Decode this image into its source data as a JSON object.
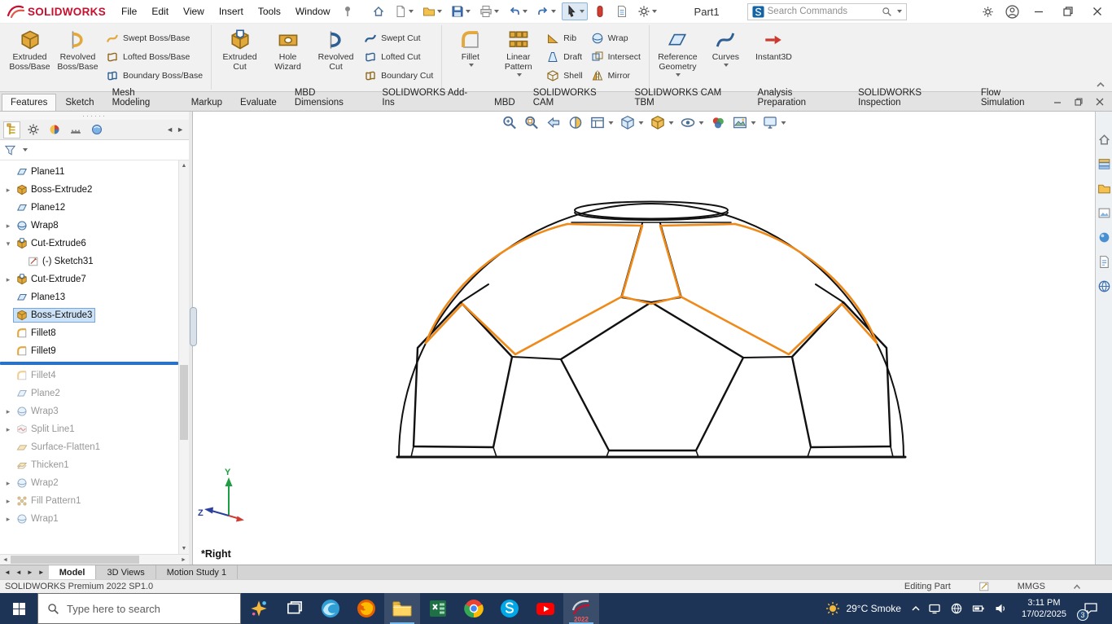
{
  "title_bar": {
    "brand": "SOLIDWORKS",
    "menus": [
      "File",
      "Edit",
      "View",
      "Insert",
      "Tools",
      "Window"
    ],
    "quick_access": [
      {
        "name": "home",
        "caret": false
      },
      {
        "name": "new-document",
        "caret": true
      },
      {
        "name": "open",
        "caret": true
      },
      {
        "name": "save",
        "caret": true
      },
      {
        "name": "print",
        "caret": true
      },
      {
        "name": "undo",
        "caret": true
      },
      {
        "name": "redo",
        "caret": true
      },
      {
        "name": "select",
        "caret": true,
        "active": true
      },
      {
        "name": "rebuild",
        "caret": false
      },
      {
        "name": "file-properties",
        "caret": false
      },
      {
        "name": "options",
        "caret": true
      }
    ],
    "document_title": "Part1",
    "search_placeholder": "Search Commands"
  },
  "ribbon": {
    "groups": [
      {
        "big": [
          {
            "label": "Extruded\nBoss/Base",
            "icon": "extruded-boss"
          },
          {
            "label": "Revolved\nBoss/Base",
            "icon": "revolved-boss"
          }
        ],
        "stacks": [
          [
            {
              "label": "Swept Boss/Base",
              "icon": "swept-boss"
            },
            {
              "label": "Lofted Boss/Base",
              "icon": "lofted-boss"
            },
            {
              "label": "Boundary Boss/Base",
              "icon": "boundary-boss"
            }
          ]
        ]
      },
      {
        "big": [
          {
            "label": "Extruded\nCut",
            "icon": "extruded-cut"
          },
          {
            "label": "Hole\nWizard",
            "icon": "hole-wizard"
          },
          {
            "label": "Revolved\nCut",
            "icon": "revolved-cut"
          }
        ],
        "stacks": [
          [
            {
              "label": "Swept Cut",
              "icon": "swept-cut"
            },
            {
              "label": "Lofted Cut",
              "icon": "lofted-cut"
            },
            {
              "label": "Boundary Cut",
              "icon": "boundary-cut"
            }
          ]
        ]
      },
      {
        "big": [
          {
            "label": "Fillet",
            "icon": "fillet",
            "caret": true
          },
          {
            "label": "Linear\nPattern",
            "icon": "linear-pattern",
            "caret": true
          }
        ],
        "stacks": [
          [
            {
              "label": "Rib",
              "icon": "rib"
            },
            {
              "label": "Draft",
              "icon": "draft"
            },
            {
              "label": "Shell",
              "icon": "shell"
            }
          ],
          [
            {
              "label": "Wrap",
              "icon": "wrap"
            },
            {
              "label": "Intersect",
              "icon": "intersect"
            },
            {
              "label": "Mirror",
              "icon": "mirror"
            }
          ]
        ]
      },
      {
        "big": [
          {
            "label": "Reference\nGeometry",
            "icon": "reference-geometry",
            "caret": true
          },
          {
            "label": "Curves",
            "icon": "curves",
            "caret": true
          },
          {
            "label": "Instant3D",
            "icon": "instant3d"
          }
        ],
        "stacks": []
      }
    ]
  },
  "command_manager": {
    "tabs": [
      {
        "label": "Features",
        "active": true
      },
      {
        "label": "Sketch"
      },
      {
        "label": "Mesh Modeling"
      },
      {
        "label": "Markup"
      },
      {
        "label": "Evaluate"
      },
      {
        "label": "MBD Dimensions"
      },
      {
        "label": "SOLIDWORKS Add-Ins"
      },
      {
        "label": "MBD"
      },
      {
        "label": "SOLIDWORKS CAM"
      },
      {
        "label": "SOLIDWORKS CAM TBM"
      },
      {
        "label": "Analysis Preparation"
      },
      {
        "label": "SOLIDWORKS Inspection"
      },
      {
        "label": "Flow Simulation"
      }
    ]
  },
  "feature_tree": {
    "items": [
      {
        "label": "Plane11",
        "icon": "plane"
      },
      {
        "label": "Boss-Extrude2",
        "icon": "boss-extrude",
        "expand": "collapsed"
      },
      {
        "label": "Plane12",
        "icon": "plane"
      },
      {
        "label": "Wrap8",
        "icon": "wrap",
        "expand": "collapsed"
      },
      {
        "label": "Cut-Extrude6",
        "icon": "cut-extrude",
        "expand": "expanded"
      },
      {
        "label": "(-) Sketch31",
        "icon": "sketch",
        "indent": 1
      },
      {
        "label": "Cut-Extrude7",
        "icon": "cut-extrude",
        "expand": "collapsed"
      },
      {
        "label": "Plane13",
        "icon": "plane"
      },
      {
        "label": "Boss-Extrude3",
        "icon": "boss-extrude",
        "selected": true
      },
      {
        "label": "Fillet8",
        "icon": "fillet"
      },
      {
        "label": "Fillet9",
        "icon": "fillet"
      },
      {
        "label": "Fillet4",
        "icon": "fillet",
        "dimmed": true,
        "rollback_before": true
      },
      {
        "label": "Plane2",
        "icon": "plane",
        "dimmed": true
      },
      {
        "label": "Wrap3",
        "icon": "wrap",
        "expand": "collapsed",
        "dimmed": true
      },
      {
        "label": "Split Line1",
        "icon": "split-line",
        "expand": "collapsed",
        "dimmed": true
      },
      {
        "label": "Surface-Flatten1",
        "icon": "surface-flatten",
        "dimmed": true
      },
      {
        "label": "Thicken1",
        "icon": "thicken",
        "dimmed": true
      },
      {
        "label": "Wrap2",
        "icon": "wrap",
        "expand": "collapsed",
        "dimmed": true
      },
      {
        "label": "Fill Pattern1",
        "icon": "fill-pattern",
        "expand": "collapsed",
        "dimmed": true
      },
      {
        "label": "Wrap1",
        "icon": "wrap",
        "expand": "collapsed",
        "dimmed": true
      }
    ]
  },
  "viewport": {
    "view_label": "*Right",
    "triad": {
      "y": "Y",
      "z": "Z"
    },
    "accent_color": "#ef8a1a",
    "edge_color": "#111111",
    "toolbar": [
      {
        "name": "zoom-fit"
      },
      {
        "name": "zoom-area"
      },
      {
        "name": "previous-view"
      },
      {
        "name": "section-view"
      },
      {
        "name": "3d-drawing-view",
        "caret": true
      },
      {
        "name": "view-orientation",
        "caret": true
      },
      {
        "name": "display-style",
        "caret": true
      },
      {
        "name": "hide-show-items",
        "caret": true
      },
      {
        "name": "edit-appearance"
      },
      {
        "name": "apply-scene",
        "caret": true
      },
      {
        "name": "view-settings",
        "caret": true
      }
    ]
  },
  "task_pane": {
    "icons": [
      {
        "name": "task-pane-home"
      },
      {
        "name": "design-library"
      },
      {
        "name": "file-explorer-pane"
      },
      {
        "name": "view-palette"
      },
      {
        "name": "appearances-scenes"
      },
      {
        "name": "custom-properties"
      },
      {
        "name": "solidworks-forum"
      }
    ]
  },
  "document_tabs": {
    "tabs": [
      {
        "label": "Model",
        "active": true
      },
      {
        "label": "3D Views"
      },
      {
        "label": "Motion Study 1"
      }
    ]
  },
  "status_bar": {
    "left": "SOLIDWORKS Premium 2022 SP1.0",
    "editing": "Editing Part",
    "units": "MMGS"
  },
  "taskbar": {
    "search_placeholder": "Type here to search",
    "apps": [
      {
        "name": "edge"
      },
      {
        "name": "firefox"
      },
      {
        "name": "file-explorer",
        "active": true
      },
      {
        "name": "excel"
      },
      {
        "name": "chrome"
      },
      {
        "name": "skype"
      },
      {
        "name": "youtube"
      },
      {
        "name": "solidworks",
        "active": true,
        "badge": "2022"
      }
    ],
    "tray": {
      "weather": "29°C Smoke",
      "time": "3:11 PM",
      "date": "17/02/2025",
      "notifications": "3"
    }
  }
}
